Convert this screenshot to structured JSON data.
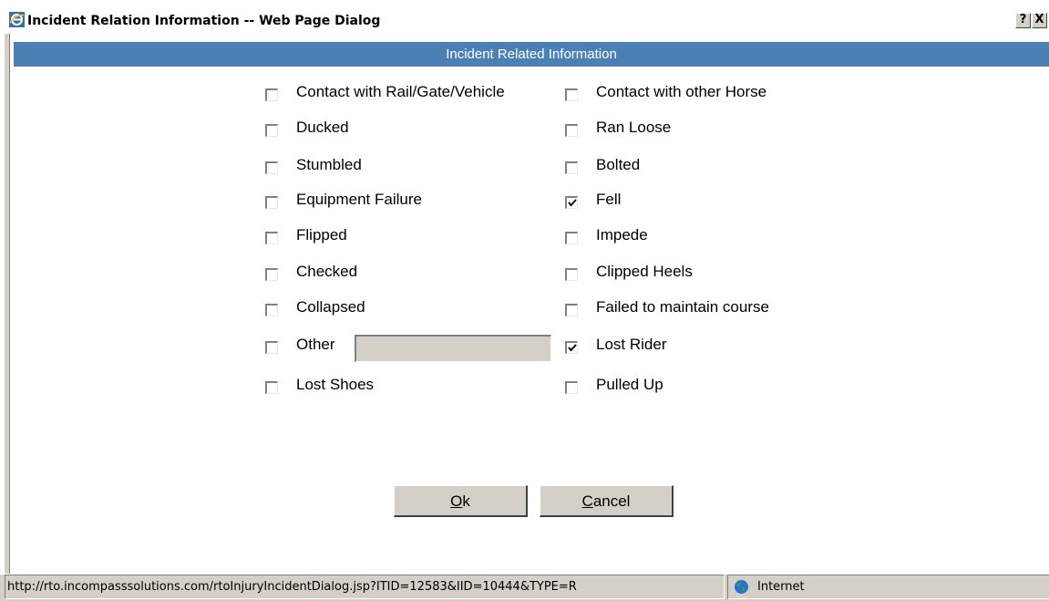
{
  "window": {
    "title": "Incident Relation Information -- Web Page Dialog",
    "help_label": "?",
    "close_label": "X",
    "title_icon": "ie-icon"
  },
  "header": {
    "title": "Incident Related Information"
  },
  "options": {
    "left": [
      {
        "label": "Contact with Rail/Gate/Vehicle",
        "checked": false
      },
      {
        "label": "Ducked",
        "checked": false
      },
      {
        "label": "Stumbled",
        "checked": false
      },
      {
        "label": "Equipment Failure",
        "checked": false
      },
      {
        "label": "Flipped",
        "checked": false
      },
      {
        "label": "Checked",
        "checked": false
      },
      {
        "label": "Collapsed",
        "checked": false
      },
      {
        "label": "Other",
        "checked": false
      },
      {
        "label": "Lost Shoes",
        "checked": false
      }
    ],
    "right": [
      {
        "label": "Contact with other Horse",
        "checked": false
      },
      {
        "label": "Ran Loose",
        "checked": false
      },
      {
        "label": "Bolted",
        "checked": false
      },
      {
        "label": "Fell",
        "checked": true
      },
      {
        "label": "Impede",
        "checked": false
      },
      {
        "label": "Clipped Heels",
        "checked": false
      },
      {
        "label": "Failed to maintain course",
        "checked": false
      },
      {
        "label": "Lost Rider",
        "checked": true
      },
      {
        "label": "Pulled Up",
        "checked": false
      }
    ],
    "other_value": ""
  },
  "buttons": {
    "ok_mnemonic": "O",
    "ok_rest": "k",
    "cancel_mnemonic": "C",
    "cancel_rest": "ancel"
  },
  "status": {
    "url": "http://rto.incompasssolutions.com/rtoInjuryIncidentDialog.jsp?ITID=12583&IID=10444&TYPE=R",
    "zone": "Internet"
  },
  "colors": {
    "header_bg": "#4a80b3",
    "dialog_face": "#d4d0c8"
  }
}
